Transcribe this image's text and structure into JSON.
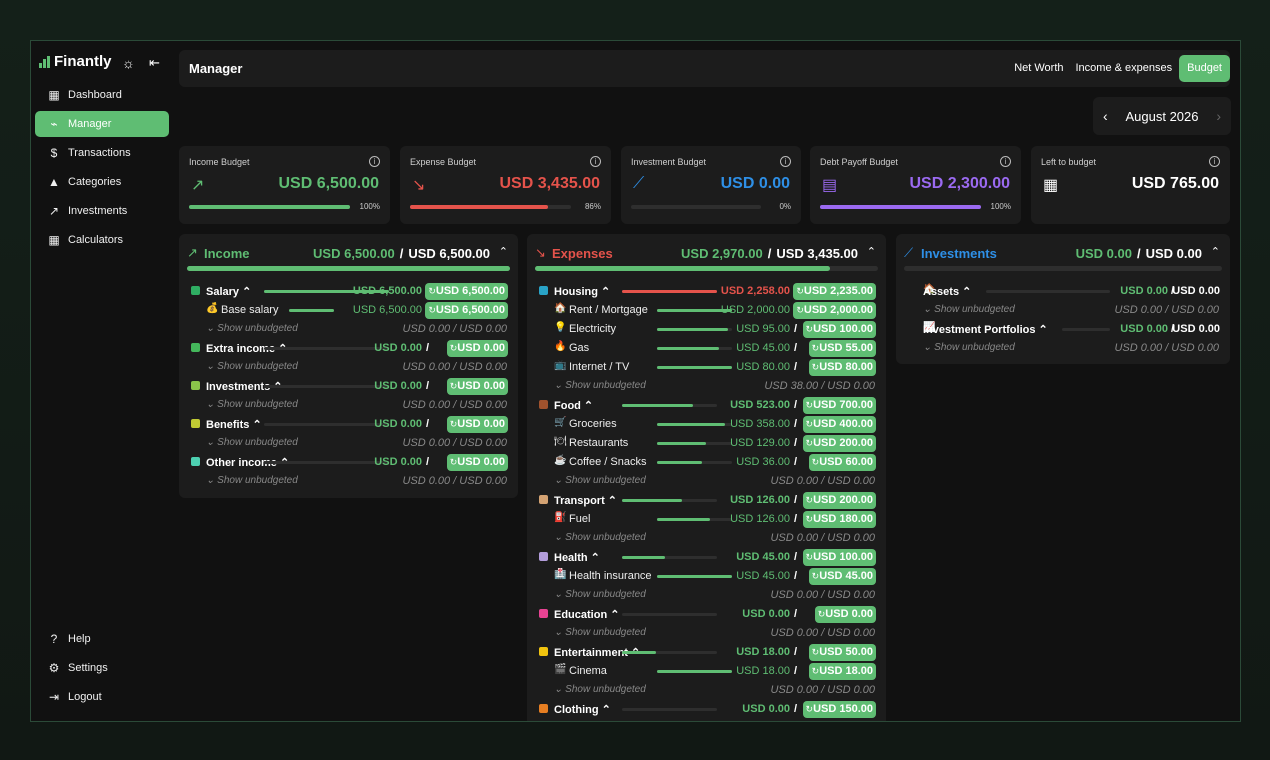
{
  "app": {
    "name": "Finantly",
    "sun_icon": "☼",
    "collapse_icon": "⇤"
  },
  "sidebar": {
    "items": [
      {
        "label": "Dashboard",
        "icon": "▦",
        "icon_name": "dashboard-icon"
      },
      {
        "label": "Manager",
        "icon": "⌁",
        "icon_name": "manager-icon",
        "active": true
      },
      {
        "label": "Transactions",
        "icon": "$",
        "icon_name": "dollar-icon"
      },
      {
        "label": "Categories",
        "icon": "▲",
        "icon_name": "categories-icon"
      },
      {
        "label": "Investments",
        "icon": "↗",
        "icon_name": "trend-icon"
      },
      {
        "label": "Calculators",
        "icon": "▦",
        "icon_name": "calculator-icon"
      }
    ],
    "bottom": [
      {
        "label": "Help",
        "icon": "?",
        "icon_name": "help-icon"
      },
      {
        "label": "Settings",
        "icon": "⚙",
        "icon_name": "gear-icon"
      },
      {
        "label": "Logout",
        "icon": "⇥",
        "icon_name": "logout-icon"
      }
    ]
  },
  "header": {
    "title": "Manager",
    "tabs": [
      {
        "label": "Net Worth"
      },
      {
        "label": "Income & expenses"
      },
      {
        "label": "Budget",
        "active": true
      }
    ]
  },
  "month": {
    "label": "August 2026",
    "prev": "‹",
    "next": "›"
  },
  "colors": {
    "accent": "#5fbd73",
    "red": "#e5534b",
    "blue": "#2e8fe6",
    "purple": "#9b6af1"
  },
  "cards": [
    {
      "title": "Income Budget",
      "value": "USD 6,500.00",
      "pct": "100%",
      "progress": 1.0,
      "icon": "↗",
      "color": "#5fbd73"
    },
    {
      "title": "Expense Budget",
      "value": "USD 3,435.00",
      "pct": "86%",
      "progress": 0.86,
      "icon": "↘",
      "color": "#e5534b"
    },
    {
      "title": "Investment Budget",
      "value": "USD 0.00",
      "pct": "0%",
      "progress": 0.0,
      "icon": "⟋",
      "color": "#2e8fe6"
    },
    {
      "title": "Debt Payoff Budget",
      "value": "USD 2,300.00",
      "pct": "100%",
      "progress": 1.0,
      "icon": "▤",
      "color": "#9b6af1"
    },
    {
      "title": "Left to budget",
      "value": "USD 765.00",
      "icon": "▦",
      "color": "#ffffff"
    }
  ],
  "income": {
    "title": "Income",
    "spent": "USD 6,500.00",
    "sep": "/",
    "budget": "USD 6,500.00",
    "progress": 1.0,
    "rows": [
      {
        "type": "cat",
        "name": "Salary ⌃",
        "color": "#2fae63",
        "amt": "USD 6,500.00",
        "pill": "USD 6,500.00",
        "progress": 1.0
      },
      {
        "type": "sub",
        "emoji": "💰",
        "name": "Base salary",
        "amt": "USD 6,500.00",
        "pill": "USD 6,500.00",
        "progress": 1.0
      },
      {
        "type": "unb",
        "label": "⌄  Show unbudgeted",
        "amt": "USD 0.00 / USD 0.00"
      },
      {
        "type": "cat",
        "name": "Extra income ⌃",
        "color": "#44b75b",
        "amt": "USD 0.00",
        "pill": "USD 0.00",
        "progress": 0.0
      },
      {
        "type": "unb",
        "label": "⌄  Show unbudgeted",
        "amt": "USD 0.00 / USD 0.00"
      },
      {
        "type": "cat",
        "name": "Investments ⌃",
        "color": "#8bc34a",
        "amt": "USD 0.00",
        "pill": "USD 0.00",
        "progress": 0.0
      },
      {
        "type": "unb",
        "label": "⌄  Show unbudgeted",
        "amt": "USD 0.00 / USD 0.00"
      },
      {
        "type": "cat",
        "name": "Benefits ⌃",
        "color": "#c0ca33",
        "amt": "USD 0.00",
        "pill": "USD 0.00",
        "progress": 0.0
      },
      {
        "type": "unb",
        "label": "⌄  Show unbudgeted",
        "amt": "USD 0.00 / USD 0.00"
      },
      {
        "type": "cat",
        "name": "Other income ⌃",
        "color": "#4dd0b1",
        "amt": "USD 0.00",
        "pill": "USD 0.00",
        "progress": 0.0
      },
      {
        "type": "unb",
        "label": "⌄  Show unbudgeted",
        "amt": "USD 0.00 / USD 0.00"
      }
    ]
  },
  "expenses": {
    "title": "Expenses",
    "spent": "USD 2,970.00",
    "sep": "/",
    "budget": "USD 3,435.00",
    "progress": 0.86,
    "rows": [
      {
        "type": "cat",
        "name": "Housing ⌃",
        "color": "#29a3c7",
        "amt": "USD 2,258.00",
        "pill": "USD 2,235.00",
        "progress": 1.0,
        "over": true
      },
      {
        "type": "sub",
        "emoji": "🏠",
        "name": "Rent / Mortgage",
        "amt": "USD 2,000.00",
        "pill": "USD 2,000.00",
        "progress": 1.0
      },
      {
        "type": "sub",
        "emoji": "💡",
        "name": "Electricity",
        "amt": "USD 95.00",
        "pill": "USD 100.00",
        "progress": 0.95
      },
      {
        "type": "sub",
        "emoji": "🔥",
        "name": "Gas",
        "amt": "USD 45.00",
        "pill": "USD 55.00",
        "progress": 0.82
      },
      {
        "type": "sub",
        "emoji": "📺",
        "name": "Internet / TV",
        "amt": "USD 80.00",
        "pill": "USD 80.00",
        "progress": 1.0
      },
      {
        "type": "unb",
        "label": "⌄  Show unbudgeted",
        "amt": "USD 38.00 / USD 0.00"
      },
      {
        "type": "cat",
        "name": "Food ⌃",
        "color": "#a0522d",
        "amt": "USD 523.00",
        "pill": "USD 700.00",
        "progress": 0.75
      },
      {
        "type": "sub",
        "emoji": "🛒",
        "name": "Groceries",
        "amt": "USD 358.00",
        "pill": "USD 400.00",
        "progress": 0.9
      },
      {
        "type": "sub",
        "emoji": "🍽",
        "name": "Restaurants",
        "amt": "USD 129.00",
        "pill": "USD 200.00",
        "progress": 0.65
      },
      {
        "type": "sub",
        "emoji": "☕",
        "name": "Coffee / Snacks",
        "amt": "USD 36.00",
        "pill": "USD 60.00",
        "progress": 0.6
      },
      {
        "type": "unb",
        "label": "⌄  Show unbudgeted",
        "amt": "USD 0.00 / USD 0.00"
      },
      {
        "type": "cat",
        "name": "Transport ⌃",
        "color": "#d4a373",
        "amt": "USD 126.00",
        "pill": "USD 200.00",
        "progress": 0.63
      },
      {
        "type": "sub",
        "emoji": "⛽",
        "name": "Fuel",
        "amt": "USD 126.00",
        "pill": "USD 180.00",
        "progress": 0.7
      },
      {
        "type": "unb",
        "label": "⌄  Show unbudgeted",
        "amt": "USD 0.00 / USD 0.00"
      },
      {
        "type": "cat",
        "name": "Health ⌃",
        "color": "#b39ddb",
        "amt": "USD 45.00",
        "pill": "USD 100.00",
        "progress": 0.45
      },
      {
        "type": "sub",
        "emoji": "🏥",
        "name": "Health insurance",
        "amt": "USD 45.00",
        "pill": "USD 45.00",
        "progress": 1.0
      },
      {
        "type": "unb",
        "label": "⌄  Show unbudgeted",
        "amt": "USD 0.00 / USD 0.00"
      },
      {
        "type": "cat",
        "name": "Education ⌃",
        "color": "#e84393",
        "amt": "USD 0.00",
        "pill": "USD 0.00",
        "progress": 0.0
      },
      {
        "type": "unb",
        "label": "⌄  Show unbudgeted",
        "amt": "USD 0.00 / USD 0.00"
      },
      {
        "type": "cat",
        "name": "Entertainment ⌃",
        "color": "#f1c40f",
        "amt": "USD 18.00",
        "pill": "USD 50.00",
        "progress": 0.36
      },
      {
        "type": "sub",
        "emoji": "🎬",
        "name": "Cinema",
        "amt": "USD 18.00",
        "pill": "USD 18.00",
        "progress": 1.0
      },
      {
        "type": "unb",
        "label": "⌄  Show unbudgeted",
        "amt": "USD 0.00 / USD 0.00"
      },
      {
        "type": "cat",
        "name": "Clothing ⌃",
        "color": "#e67e22",
        "amt": "USD 0.00",
        "pill": "USD 150.00",
        "progress": 0.0
      }
    ]
  },
  "investments": {
    "title": "Investments",
    "spent": "USD 0.00",
    "sep": "/",
    "budget": "USD 0.00",
    "progress": 0.0,
    "rows": [
      {
        "type": "cat2",
        "emoji": "🏠",
        "name": "Assets ⌃",
        "amt": "USD 0.00",
        "total": "USD 0.00"
      },
      {
        "type": "unb",
        "label": "⌄  Show unbudgeted",
        "amt": "USD 0.00 / USD 0.00"
      },
      {
        "type": "cat2",
        "emoji": "📈",
        "name": "Investment Portfolios ⌃",
        "amt": "USD 0.00",
        "total": "USD 0.00"
      },
      {
        "type": "unb",
        "label": "⌄  Show unbudgeted",
        "amt": "USD 0.00 / USD 0.00"
      }
    ]
  }
}
